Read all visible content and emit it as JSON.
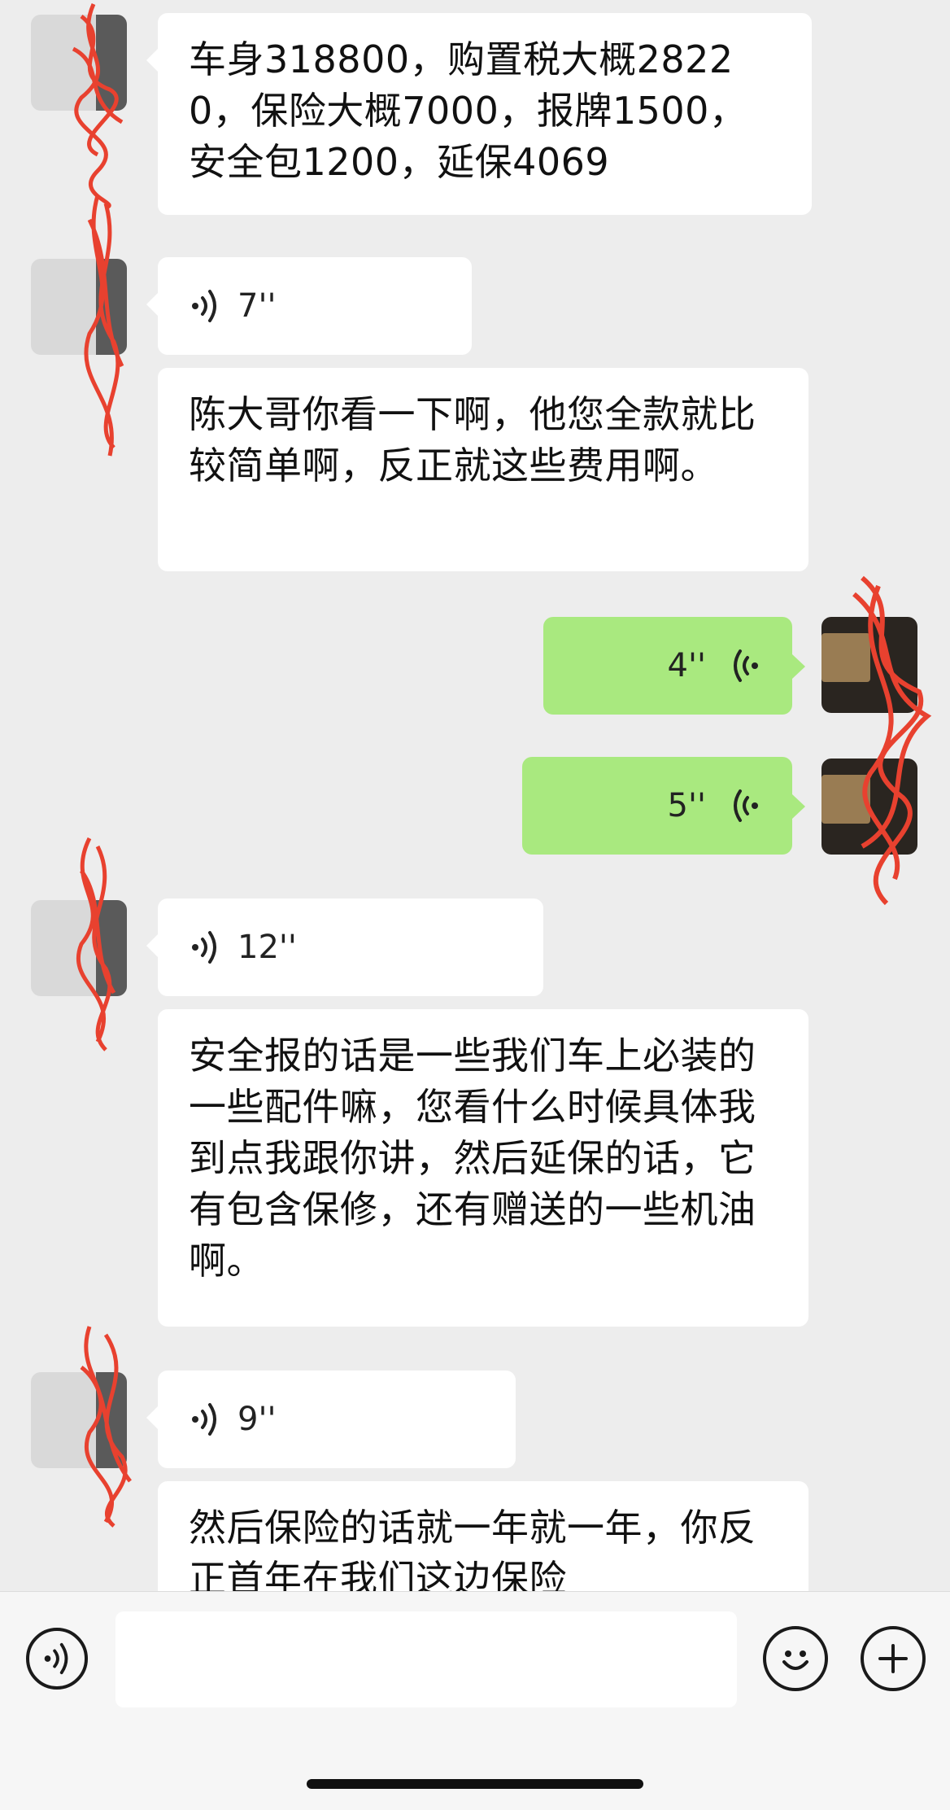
{
  "messages": [
    {
      "side": "left",
      "type": "text",
      "text": "车身318800，购置税大概28220，保险大概7000，报牌1500，安全包1200，延保4069"
    },
    {
      "side": "left",
      "type": "voice",
      "duration": "7''"
    },
    {
      "side": "left",
      "type": "text",
      "text": "陈大哥你看一下啊，他您全款就比较简单啊，反正就这些费用啊。"
    },
    {
      "side": "right",
      "type": "voice",
      "duration": "4''"
    },
    {
      "side": "right",
      "type": "voice",
      "duration": "5''"
    },
    {
      "side": "left",
      "type": "voice",
      "duration": "12''"
    },
    {
      "side": "left",
      "type": "text",
      "text": "安全报的话是一些我们车上必装的一些配件嘛，您看什么时候具体我到点我跟你讲，然后延保的话，它有包含保修，还有赠送的一些机油啊。"
    },
    {
      "side": "left",
      "type": "voice",
      "duration": "9''"
    },
    {
      "side": "left",
      "type": "text",
      "text": "然后保险的话就一年就一年，你反正首年在我们这边保险"
    }
  ],
  "input_bar": {
    "voice_button_icon": "voice-mode-icon",
    "input_value": "",
    "emoji_button_icon": "emoji-icon",
    "more_button_icon": "plus-icon"
  },
  "colors": {
    "background": "#ededed",
    "incoming_bubble": "#ffffff",
    "outgoing_bubble": "#a9e97f",
    "redaction": "#e8412f"
  }
}
